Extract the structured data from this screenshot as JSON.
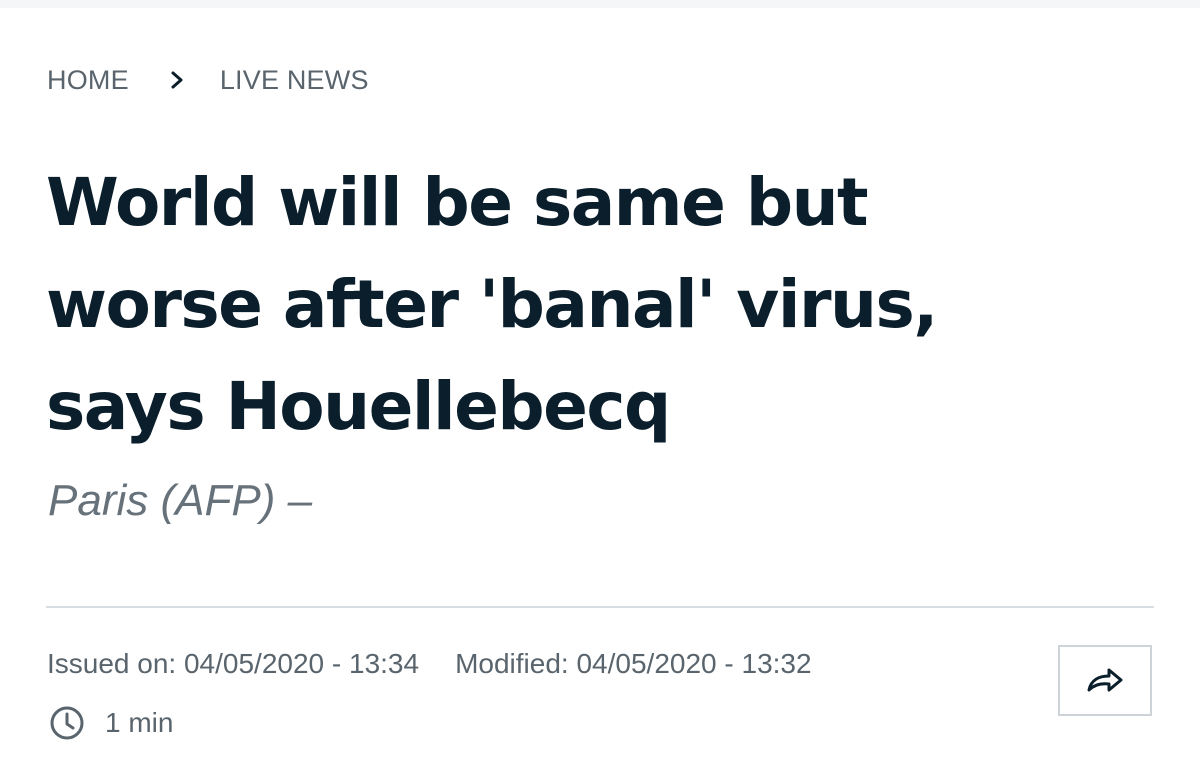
{
  "breadcrumb": {
    "home": "HOME",
    "current": "LIVE NEWS",
    "separator_icon": "chevron-right-icon"
  },
  "article": {
    "headline_lines": [
      "World will be same but",
      "worse after 'banal' virus,",
      "says Houellebecq"
    ],
    "dateline": "Paris (AFP) –",
    "issued": "Issued on: 04/05/2020 - 13:34",
    "modified": "Modified: 04/05/2020 - 13:32",
    "read_time": "1 min",
    "read_time_icon": "clock-icon",
    "share_icon": "share-arrow-icon"
  },
  "colors": {
    "headline": "#0b1e2b",
    "muted_text": "#59646c",
    "divider": "#d8dde2"
  }
}
